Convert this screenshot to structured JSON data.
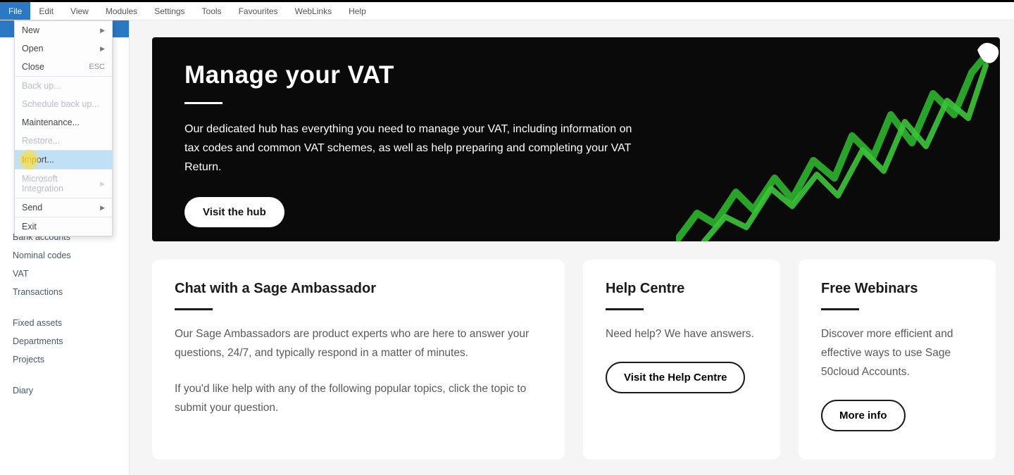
{
  "menubar": [
    "File",
    "Edit",
    "View",
    "Modules",
    "Settings",
    "Tools",
    "Favourites",
    "WebLinks",
    "Help"
  ],
  "dropdown": [
    {
      "label": "New",
      "sub": true
    },
    {
      "label": "Open",
      "sub": true
    },
    {
      "label": "Close",
      "shortcut": "ESC"
    },
    {
      "sep": true
    },
    {
      "label": "Back up...",
      "disabled": true
    },
    {
      "label": "Schedule back up...",
      "disabled": true
    },
    {
      "label": "Maintenance..."
    },
    {
      "label": "Restore...",
      "disabled": true
    },
    {
      "sep": true
    },
    {
      "label": "Import...",
      "hovered": true
    },
    {
      "sep": true
    },
    {
      "label": "Microsoft Integration",
      "sub": true,
      "disabled": true
    },
    {
      "sep": true
    },
    {
      "label": "Send",
      "sub": true
    },
    {
      "sep": true
    },
    {
      "label": "Exit"
    }
  ],
  "sidebar": {
    "group1": [
      "Bank accounts",
      "Nominal codes",
      "VAT",
      "Transactions"
    ],
    "group2": [
      "Fixed assets",
      "Departments",
      "Projects"
    ],
    "group3": [
      "Diary"
    ]
  },
  "hero": {
    "title": "Manage your VAT",
    "body": "Our dedicated hub has everything you need to manage your VAT, including information on tax codes and common VAT schemes, as well as help preparing and completing your VAT Return.",
    "button": "Visit the hub"
  },
  "cards": {
    "chat": {
      "title": "Chat with a Sage Ambassador",
      "p1": "Our Sage Ambassadors are product experts who are here to answer your questions, 24/7, and typically respond in a matter of minutes.",
      "p2": "If you'd like help with any of the following popular topics, click the topic to submit your question."
    },
    "help": {
      "title": "Help Centre",
      "body": "Need help? We have answers.",
      "button": "Visit the Help Centre"
    },
    "webinars": {
      "title": "Free Webinars",
      "body": "Discover more efficient and effective ways to use Sage 50cloud Accounts.",
      "button": "More info"
    }
  }
}
